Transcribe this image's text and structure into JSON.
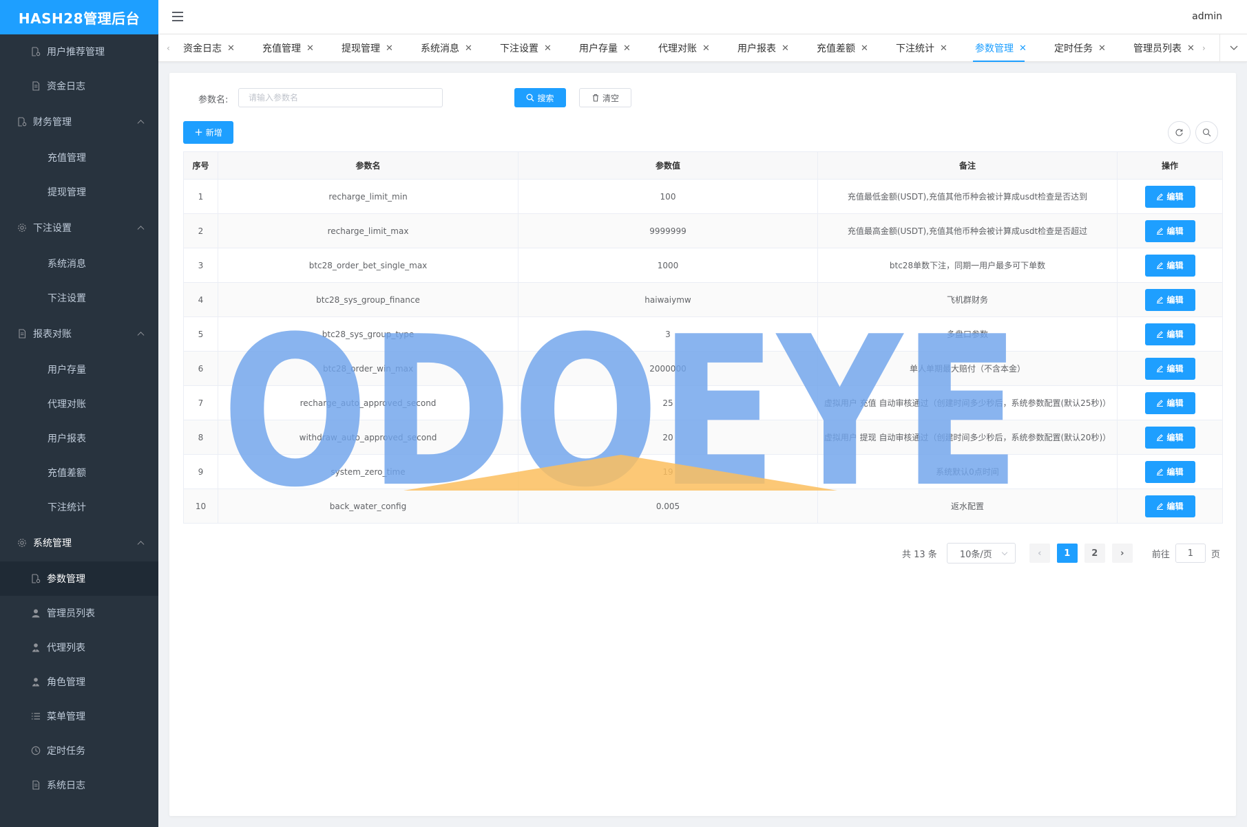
{
  "app": {
    "title": "HASH28管理后台",
    "user": "admin"
  },
  "sidebar": {
    "items": [
      {
        "label": "用户推荐管理",
        "icon": "doc-gear-icon",
        "type": "item"
      },
      {
        "label": "资金日志",
        "icon": "doc-icon",
        "type": "item"
      },
      {
        "label": "财务管理",
        "icon": "doc-gear-icon",
        "type": "group"
      },
      {
        "label": "充值管理",
        "type": "child"
      },
      {
        "label": "提现管理",
        "type": "child"
      },
      {
        "label": "下注设置",
        "icon": "gear-icon",
        "type": "group"
      },
      {
        "label": "系统消息",
        "type": "child"
      },
      {
        "label": "下注设置",
        "type": "child"
      },
      {
        "label": "报表对账",
        "icon": "doc-icon",
        "type": "group"
      },
      {
        "label": "用户存量",
        "type": "child"
      },
      {
        "label": "代理对账",
        "type": "child"
      },
      {
        "label": "用户报表",
        "type": "child"
      },
      {
        "label": "充值差额",
        "type": "child"
      },
      {
        "label": "下注统计",
        "type": "child"
      },
      {
        "label": "系统管理",
        "icon": "gear-icon",
        "type": "group"
      },
      {
        "label": "参数管理",
        "icon": "doc-gear-icon",
        "type": "item",
        "active": true
      },
      {
        "label": "管理员列表",
        "icon": "user-icon",
        "type": "item"
      },
      {
        "label": "代理列表",
        "icon": "user-tie-icon",
        "type": "item"
      },
      {
        "label": "角色管理",
        "icon": "user-tie-icon",
        "type": "item"
      },
      {
        "label": "菜单管理",
        "icon": "list-icon",
        "type": "item"
      },
      {
        "label": "定时任务",
        "icon": "clock-icon",
        "type": "item"
      },
      {
        "label": "系统日志",
        "icon": "doc-icon",
        "type": "item"
      }
    ]
  },
  "tabs": [
    {
      "label": "资金日志"
    },
    {
      "label": "充值管理"
    },
    {
      "label": "提现管理"
    },
    {
      "label": "系统消息"
    },
    {
      "label": "下注设置"
    },
    {
      "label": "用户存量"
    },
    {
      "label": "代理对账"
    },
    {
      "label": "用户报表"
    },
    {
      "label": "充值差额"
    },
    {
      "label": "下注统计"
    },
    {
      "label": "参数管理",
      "active": true
    },
    {
      "label": "定时任务"
    },
    {
      "label": "管理员列表"
    }
  ],
  "search": {
    "label": "参数名:",
    "placeholder": "请输入参数名",
    "value": "",
    "search_label": "搜索",
    "clear_label": "清空"
  },
  "toolbar": {
    "add_label": "新增"
  },
  "table": {
    "headers": [
      "序号",
      "参数名",
      "参数值",
      "备注",
      "操作"
    ],
    "edit_label": "编辑",
    "rows": [
      {
        "no": "1",
        "name": "recharge_limit_min",
        "value": "100",
        "remark": "充值最低金额(USDT),充值其他币种会被计算成usdt检查是否达到"
      },
      {
        "no": "2",
        "name": "recharge_limit_max",
        "value": "9999999",
        "remark": "充值最高金额(USDT),充值其他币种会被计算成usdt检查是否超过"
      },
      {
        "no": "3",
        "name": "btc28_order_bet_single_max",
        "value": "1000",
        "remark": "btc28单数下注，同期一用户最多可下单数"
      },
      {
        "no": "4",
        "name": "btc28_sys_group_finance",
        "value": "haiwaiymw",
        "remark": "飞机群财务"
      },
      {
        "no": "5",
        "name": "btc28_sys_group_type",
        "value": "3",
        "remark": "多盘口参数"
      },
      {
        "no": "6",
        "name": "btc28_order_win_max",
        "value": "2000000",
        "remark": "单人单期最大赔付（不含本金）"
      },
      {
        "no": "7",
        "name": "recharge_auto_approved_second",
        "value": "25",
        "remark": "虚拟用户 充值 自动审核通过（创建时间多少秒后，系统参数配置(默认25秒)）"
      },
      {
        "no": "8",
        "name": "withdraw_auto_approved_second",
        "value": "20",
        "remark": "虚拟用户 提现 自动审核通过（创建时间多少秒后，系统参数配置(默认20秒)）"
      },
      {
        "no": "9",
        "name": "system_zero_time",
        "value": "19",
        "remark": "系统默认0点时间"
      },
      {
        "no": "10",
        "name": "back_water_config",
        "value": "0.005",
        "remark": "返水配置"
      }
    ]
  },
  "pagination": {
    "total_text": "共 13 条",
    "page_size": "10条/页",
    "pages": [
      "1",
      "2"
    ],
    "current": "1",
    "goto_prefix": "前往",
    "goto_value": "1",
    "goto_suffix": "页"
  },
  "watermark": {
    "text": "ODOEYE",
    "color": "#6fa3ec",
    "accent": "#fbbe5e"
  },
  "colors": {
    "primary": "#1e9fff",
    "sidebar_bg": "#28333e",
    "logo_bg": "#1e9fff"
  }
}
